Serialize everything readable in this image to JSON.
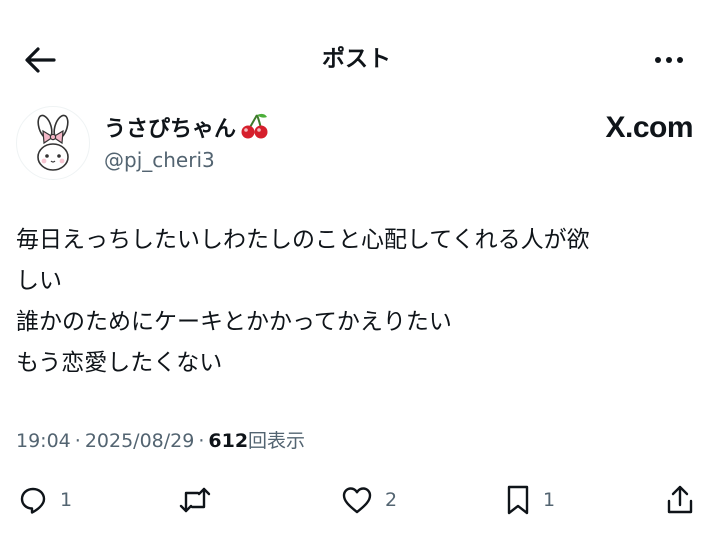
{
  "header": {
    "title": "ポスト"
  },
  "author": {
    "display_name": "うさぴちゃん",
    "handle": "@pj_cheri3"
  },
  "watermark": "X.com",
  "post": {
    "lines": [
      "毎日えっちしたいしわたしのこと心配してくれる人が欲",
      "しい",
      "誰かのためにケーキとかかってかえりたい",
      "もう恋愛したくない"
    ],
    "time": "19:04",
    "date": "2025/08/29",
    "separator": "·",
    "views_count": "612",
    "views_label": "回表示"
  },
  "actions": {
    "reply_count": "1",
    "retweet_count": "",
    "like_count": "2",
    "bookmark_count": "1"
  },
  "icons": {
    "back": "arrow-left-icon",
    "more": "more-horizontal-icon",
    "cherry": "cherry-emoji-icon",
    "reply": "reply-icon",
    "retweet": "retweet-icon",
    "like": "heart-icon",
    "bookmark": "bookmark-icon",
    "share": "share-icon"
  },
  "colors": {
    "text": "#0f1419",
    "secondary": "#536471",
    "cherry": "#d61f2c"
  }
}
